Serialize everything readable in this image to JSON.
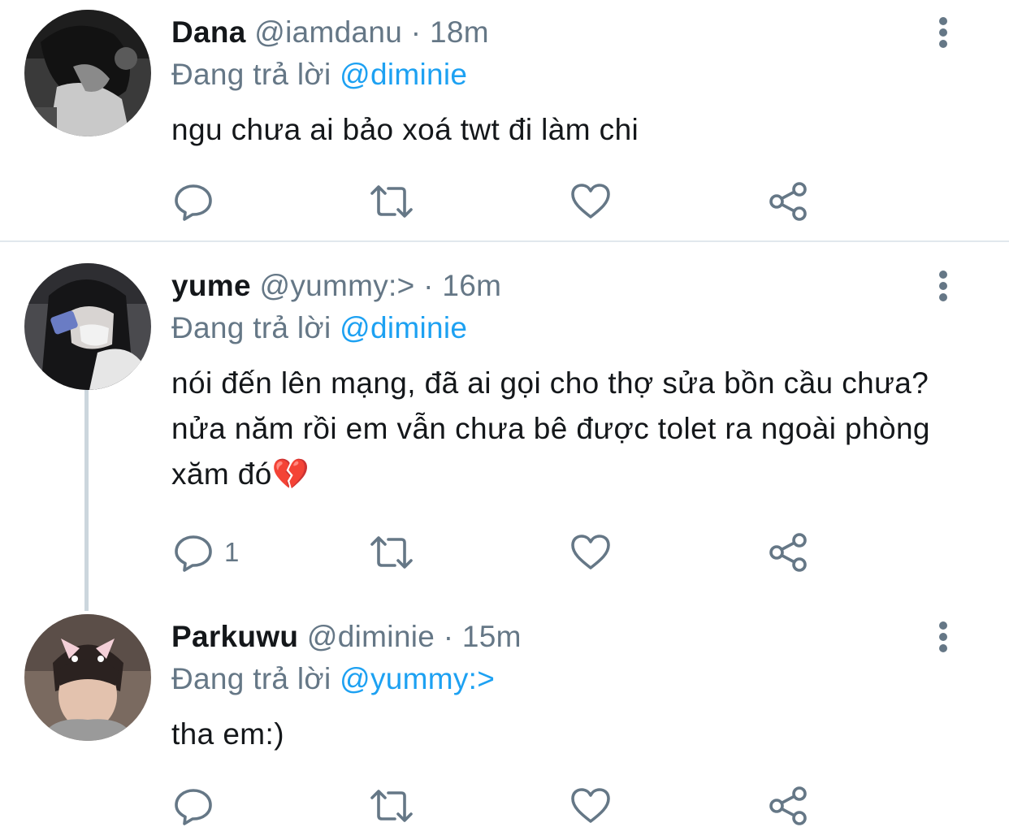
{
  "tweets": [
    {
      "name": "Dana",
      "handle": "@iamdanu",
      "time": "· 18m",
      "reply_prefix": "Đang trả lời",
      "reply_to": "@diminie",
      "text": "ngu chưa ai bảo xoá twt đi làm chi",
      "reply_count": "",
      "avatar": "grayscale-photo"
    },
    {
      "name": "yume",
      "handle": "@yummy:>",
      "time": "· 16m",
      "reply_prefix": "Đang trả lời",
      "reply_to": "@diminie",
      "text": "nói đến lên mạng, đã ai gọi cho thợ sửa bồn cầu chưa? nửa năm rồi em vẫn chưa bê được tolet ra ngoài phòng xăm đó💔",
      "reply_count": "1",
      "avatar": "selfie-photo"
    },
    {
      "name": "Parkuwu",
      "handle": "@diminie",
      "time": "· 15m",
      "reply_prefix": "Đang trả lời",
      "reply_to": "@yummy:>",
      "text": "tha em:)",
      "reply_count": "",
      "avatar": "portrait-photo"
    }
  ],
  "icons": {
    "reply": "reply-icon",
    "retweet": "retweet-icon",
    "like": "heart-icon",
    "share": "share-icon",
    "more": "more-vertical-icon"
  },
  "colors": {
    "text": "#14171a",
    "secondary": "#657786",
    "link": "#1da1f2",
    "divider": "#e1e8ed",
    "thread": "#ccd6dd"
  }
}
